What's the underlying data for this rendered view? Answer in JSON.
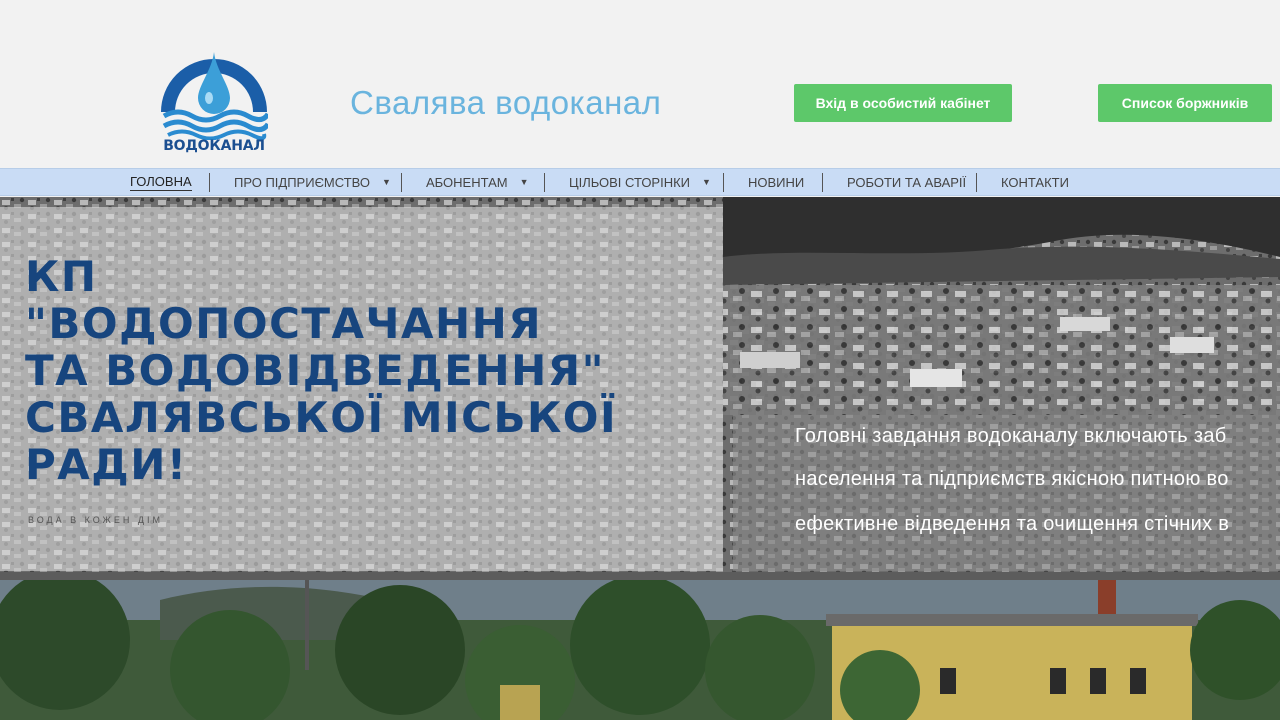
{
  "header": {
    "logo_text": "ВОДОКАНАЛ",
    "site_title": "Свалява водоканал",
    "cabinet_button": "Вхід в особистий кабінет",
    "debtors_button": "Список боржників"
  },
  "nav": {
    "items": [
      {
        "label": "ГОЛОВНА",
        "active": true
      },
      {
        "label": "ПРО ПІДПРИЄМСТВО",
        "dropdown": true
      },
      {
        "label": "АБОНЕНТАМ",
        "dropdown": true
      },
      {
        "label": "ЦІЛЬОВІ СТОРІНКИ",
        "dropdown": true
      },
      {
        "label": "НОВИНИ"
      },
      {
        "label": "РОБОТИ ТА АВАРІЇ"
      },
      {
        "label": "КОНТАКТИ"
      }
    ]
  },
  "hero": {
    "heading_lines": [
      "КП",
      "\"ВОДОПОСТАЧАННЯ",
      "ТА ВОДОВІДВЕДЕННЯ\"",
      "СВАЛЯВСЬКОЇ МІСЬКОЇ",
      "РАДИ!"
    ],
    "tagline": "ВОДА В КОЖЕН ДІМ",
    "description_lines": [
      "Головні завдання водоканалу включають заб",
      "населення та підприємств якісною питною во",
      "ефективне відведення та очищення стічних в"
    ]
  },
  "colors": {
    "accent_green": "#5dc86a",
    "title_blue": "#6ab4de",
    "heading_navy": "#17457e",
    "nav_bg": "#c9dcf5"
  },
  "icons": {
    "nav_dropdown": "caret-down-icon",
    "logo": "water-drop-logo-icon"
  }
}
